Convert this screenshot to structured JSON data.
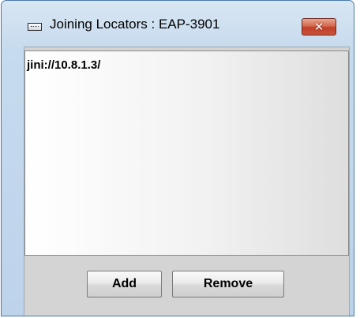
{
  "window": {
    "title": "Joining Locators : EAP-3901",
    "close_label": "✕",
    "accent_color": "#c0402a"
  },
  "locators": {
    "items": [
      "jini://10.8.1.3/"
    ]
  },
  "actions": {
    "add_label": "Add",
    "remove_label": "Remove"
  },
  "icons": {
    "app": "window-icon",
    "close": "close-icon"
  }
}
